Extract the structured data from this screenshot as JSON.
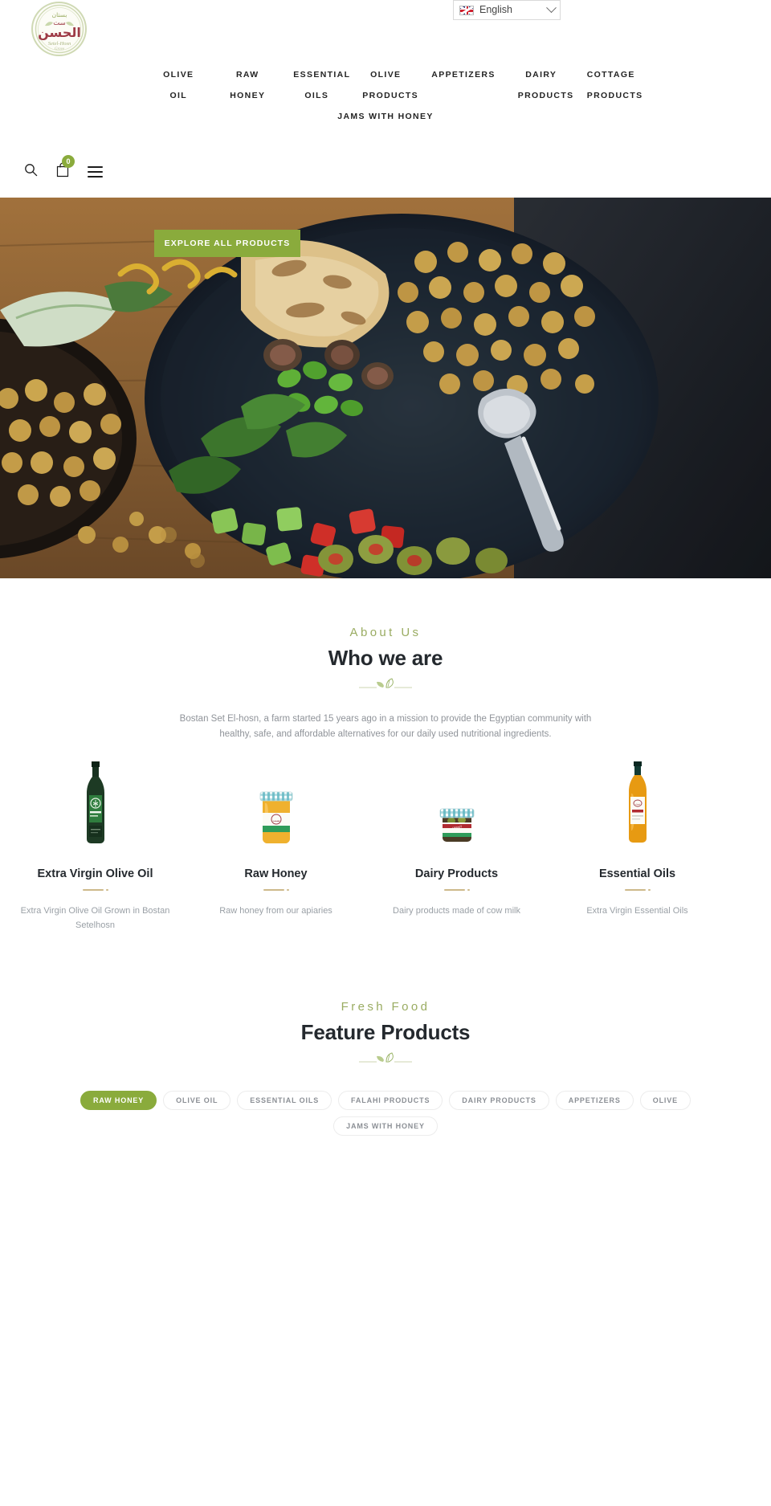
{
  "brand": {
    "logo_alt": "Bostan Set El-hosn",
    "logo_script": "Setel-Hosn",
    "logo_subscript": "Grove",
    "accent_green": "#8aab3c",
    "eyebrow_green": "#9aac62",
    "logo_maroon": "#9e3b46"
  },
  "language_selector": {
    "value": "English",
    "flag": "uk-flag-icon",
    "caret": "chevron-down-icon"
  },
  "nav": {
    "items": [
      {
        "label": "OLIVE OIL"
      },
      {
        "label": "RAW HONEY"
      },
      {
        "label": "ESSENTIAL OILS"
      },
      {
        "label": "OLIVE PRODUCTS"
      },
      {
        "label": "APPETIZERS"
      },
      {
        "label": "DAIRY PRODUCTS"
      },
      {
        "label": "COTTAGE PRODUCTS"
      },
      {
        "label": "JAMS WITH HONEY"
      }
    ]
  },
  "utility_bar": {
    "search_icon": "search-icon",
    "cart_icon": "shopping-bag-icon",
    "cart_count": "0",
    "menu_icon": "hamburger-menu-icon"
  },
  "hero": {
    "cta_label": "EXPLORE ALL PRODUCTS",
    "image_alt": "Bowl of chickpea salad with olives, figs and vegetables on a wooden table"
  },
  "about": {
    "eyebrow": "About Us",
    "title": "Who we are",
    "body": "Bostan Set El-hosn, a farm started 15 years ago in a mission to provide the Egyptian community with healthy, safe, and affordable alternatives for our daily used nutritional ingredients."
  },
  "categories": [
    {
      "title": "Extra Virgin Olive Oil",
      "description": "Extra Virgin Olive Oil Grown in Bostan Setelhosn",
      "image": "olive-oil-bottle"
    },
    {
      "title": "Raw Honey",
      "description": "Raw honey from our apiaries",
      "image": "honey-jar"
    },
    {
      "title": "Dairy Products",
      "description": "Dairy products made of cow milk",
      "image": "dairy-jar"
    },
    {
      "title": "Essential Oils",
      "description": "Extra Virgin Essential Oils",
      "image": "essential-oil-bottle"
    }
  ],
  "products": {
    "eyebrow": "Fresh Food",
    "title": "Feature Products",
    "filters": [
      {
        "label": "RAW HONEY",
        "active": true
      },
      {
        "label": "OLIVE OIL",
        "active": false
      },
      {
        "label": "ESSENTIAL OILS",
        "active": false
      },
      {
        "label": "FALAHI PRODUCTS",
        "active": false
      },
      {
        "label": "DAIRY PRODUCTS",
        "active": false
      },
      {
        "label": "APPETIZERS",
        "active": false
      },
      {
        "label": "OLIVE",
        "active": false
      },
      {
        "label": "JAMS WITH HONEY",
        "active": false
      }
    ]
  }
}
